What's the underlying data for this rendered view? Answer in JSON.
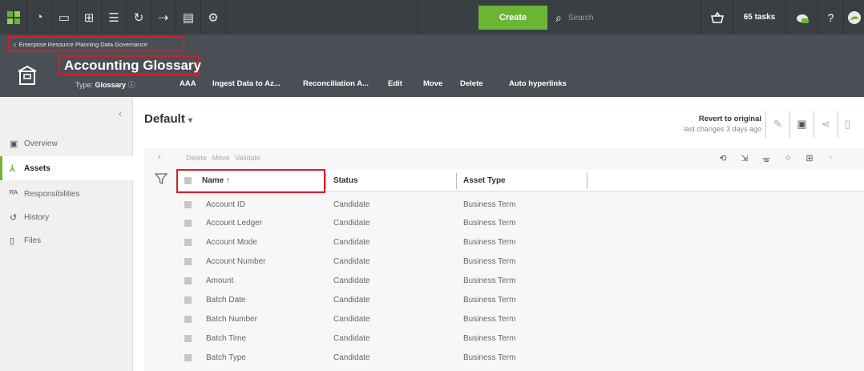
{
  "topbar": {
    "create_label": "Create",
    "search_placeholder": "Search",
    "tasks_label": "65 tasks"
  },
  "header": {
    "breadcrumb": "Enterprise Resource Planning Data Governance",
    "title": "Accounting Glossary",
    "type_prefix": "Type:",
    "type_value": "Glossary",
    "actions": [
      "AAA",
      "Ingest Data to Az...",
      "Reconciliation A...",
      "Edit",
      "Move",
      "Delete",
      "Auto hyperlinks"
    ]
  },
  "sidebar": {
    "items": [
      {
        "label": "Overview",
        "icon": "overview-icon"
      },
      {
        "label": "Assets",
        "icon": "assets-icon"
      },
      {
        "label": "Responsibilities",
        "icon": "responsibilities-icon"
      },
      {
        "label": "History",
        "icon": "history-icon"
      },
      {
        "label": "Files",
        "icon": "files-icon"
      }
    ],
    "active": "Assets"
  },
  "main": {
    "view_title": "Default",
    "revert_label": "Revert to original",
    "last_changes": "last changes 3 days ago",
    "bulk_actions": [
      "Delete",
      "Move",
      "Validate"
    ]
  },
  "table": {
    "columns": [
      "Name",
      "Status",
      "Asset Type"
    ],
    "name_sort_indicator": "↑",
    "rows": [
      {
        "name": "Account ID",
        "status": "Candidate",
        "type": "Business Term"
      },
      {
        "name": "Account Ledger",
        "status": "Candidate",
        "type": "Business Term"
      },
      {
        "name": "Account Mode",
        "status": "Candidate",
        "type": "Business Term"
      },
      {
        "name": "Account Number",
        "status": "Candidate",
        "type": "Business Term"
      },
      {
        "name": "Amount",
        "status": "Candidate",
        "type": "Business Term"
      },
      {
        "name": "Batch Date",
        "status": "Candidate",
        "type": "Business Term"
      },
      {
        "name": "Batch Number",
        "status": "Candidate",
        "type": "Business Term"
      },
      {
        "name": "Batch Time",
        "status": "Candidate",
        "type": "Business Term"
      },
      {
        "name": "Batch Type",
        "status": "Candidate",
        "type": "Business Term"
      }
    ]
  },
  "colors": {
    "accent": "#6bb536",
    "nav_bg": "#3a3f44",
    "header_bg": "#4a4f55",
    "highlight": "#d0202a"
  }
}
